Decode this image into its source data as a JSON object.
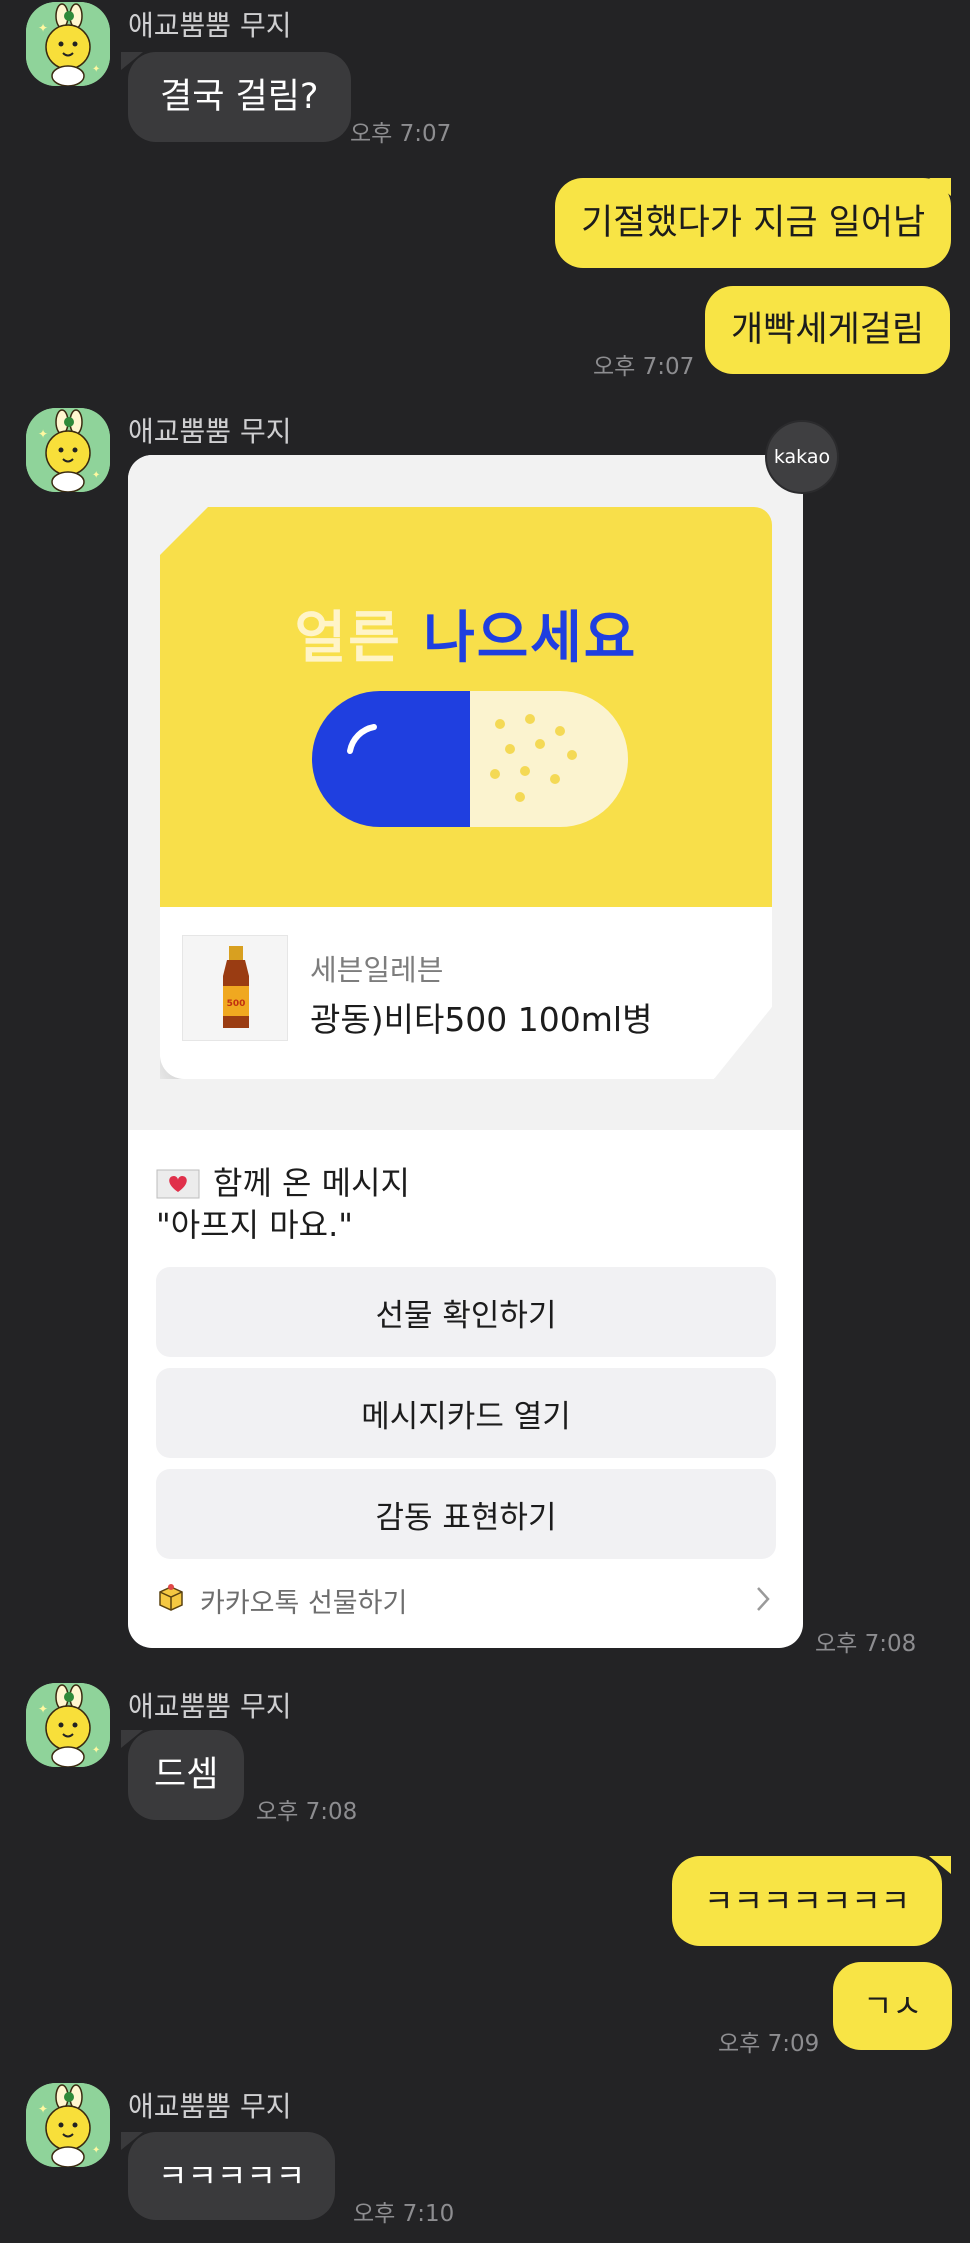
{
  "chat": {
    "msg1": {
      "sender": "애교뿜뿜 무지",
      "text": "결국 걸림?",
      "time": "오후 7:07"
    },
    "msg2": {
      "line1": "기절했다가 지금 일어남",
      "line2": "개빡세게걸림",
      "time": "오후 7:07"
    },
    "gift": {
      "sender": "애교뿜뿜 무지",
      "badge": "kakao",
      "headline_white": "얼른",
      "headline_blue": "나으세요",
      "store": "세븐일레븐",
      "product": "광동)비타500 100ml병",
      "message_title": "함께 온 메시지",
      "message_body": "\"아프지 마요.\"",
      "buttons": [
        "선물 확인하기",
        "메시지카드 열기",
        "감동 표현하기"
      ],
      "footer": "카카오톡 선물하기",
      "time": "오후 7:08"
    },
    "msg3": {
      "sender": "애교뿜뿜 무지",
      "text": "드셈",
      "time": "오후 7:08"
    },
    "msg4": {
      "line1": "ㅋㅋㅋㅋㅋㅋㅋ",
      "line2": "ㄱㅅ",
      "time": "오후 7:09"
    },
    "msg5": {
      "sender": "애교뿜뿜 무지",
      "text": "ㅋㅋㅋㅋㅋ",
      "time": "오후 7:10"
    }
  },
  "colors": {
    "background": "#232325",
    "incoming_bubble": "#3a3a3c",
    "outgoing_bubble": "#f8e445",
    "gift_yellow": "#f8df4a",
    "gift_blue": "#1f3fe0"
  },
  "icons": [
    "muzi-avatar",
    "gift-box-icon",
    "chevron-right-icon",
    "envelope-heart-icon",
    "capsule-pill",
    "vita500-bottle"
  ]
}
